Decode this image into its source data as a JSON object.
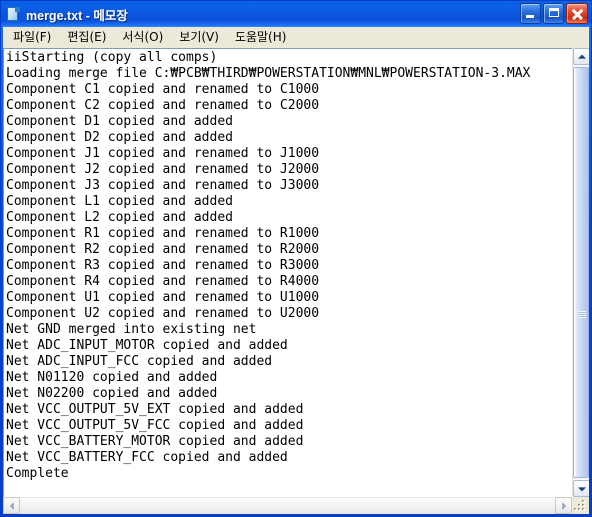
{
  "window": {
    "title": "merge.txt - 메모장",
    "icon": "notepad-document-icon",
    "accent_color": "#0a47cf",
    "titlebar_text_color": "#ffffff",
    "close_button_color": "#c92c12"
  },
  "caption_buttons": {
    "minimize": "minimize-button",
    "maximize": "maximize-button",
    "close": "close-button"
  },
  "menubar": {
    "items": [
      {
        "label": "파일(F)"
      },
      {
        "label": "편집(E)"
      },
      {
        "label": "서식(O)"
      },
      {
        "label": "보기(V)"
      },
      {
        "label": "도움말(H)"
      }
    ]
  },
  "document": {
    "lines": [
      "iiStarting (copy all comps)",
      "Loading merge file C:₩PCB₩THIRD₩POWERSTATION₩MNL₩POWERSTATION-3.MAX",
      "Component C1 copied and renamed to C1000",
      "Component C2 copied and renamed to C2000",
      "Component D1 copied and added",
      "Component D2 copied and added",
      "Component J1 copied and renamed to J1000",
      "Component J2 copied and renamed to J2000",
      "Component J3 copied and renamed to J3000",
      "Component L1 copied and added",
      "Component L2 copied and added",
      "Component R1 copied and renamed to R1000",
      "Component R2 copied and renamed to R2000",
      "Component R3 copied and renamed to R3000",
      "Component R4 copied and renamed to R4000",
      "Component U1 copied and renamed to U1000",
      "Component U2 copied and renamed to U2000",
      "Net GND merged into existing net",
      "Net ADC_INPUT_MOTOR copied and added",
      "Net ADC_INPUT_FCC copied and added",
      "Net N01120 copied and added",
      "Net N02200 copied and added",
      "Net VCC_OUTPUT_5V_EXT copied and added",
      "Net VCC_OUTPUT_5V_FCC copied and added",
      "Net VCC_BATTERY_MOTOR copied and added",
      "Net VCC_BATTERY_FCC copied and added",
      "Complete"
    ],
    "background_color": "#ffffff",
    "text_color": "#000000"
  },
  "scrollbars": {
    "vertical": {
      "up_button": "scroll-up-arrow-icon",
      "down_button": "scroll-down-arrow-icon",
      "thumb": "vertical-scroll-thumb"
    },
    "horizontal": {
      "left_button": "scroll-left-arrow-icon",
      "right_button": "scroll-right-arrow-icon"
    },
    "resize_grip": "window-resize-grip"
  }
}
